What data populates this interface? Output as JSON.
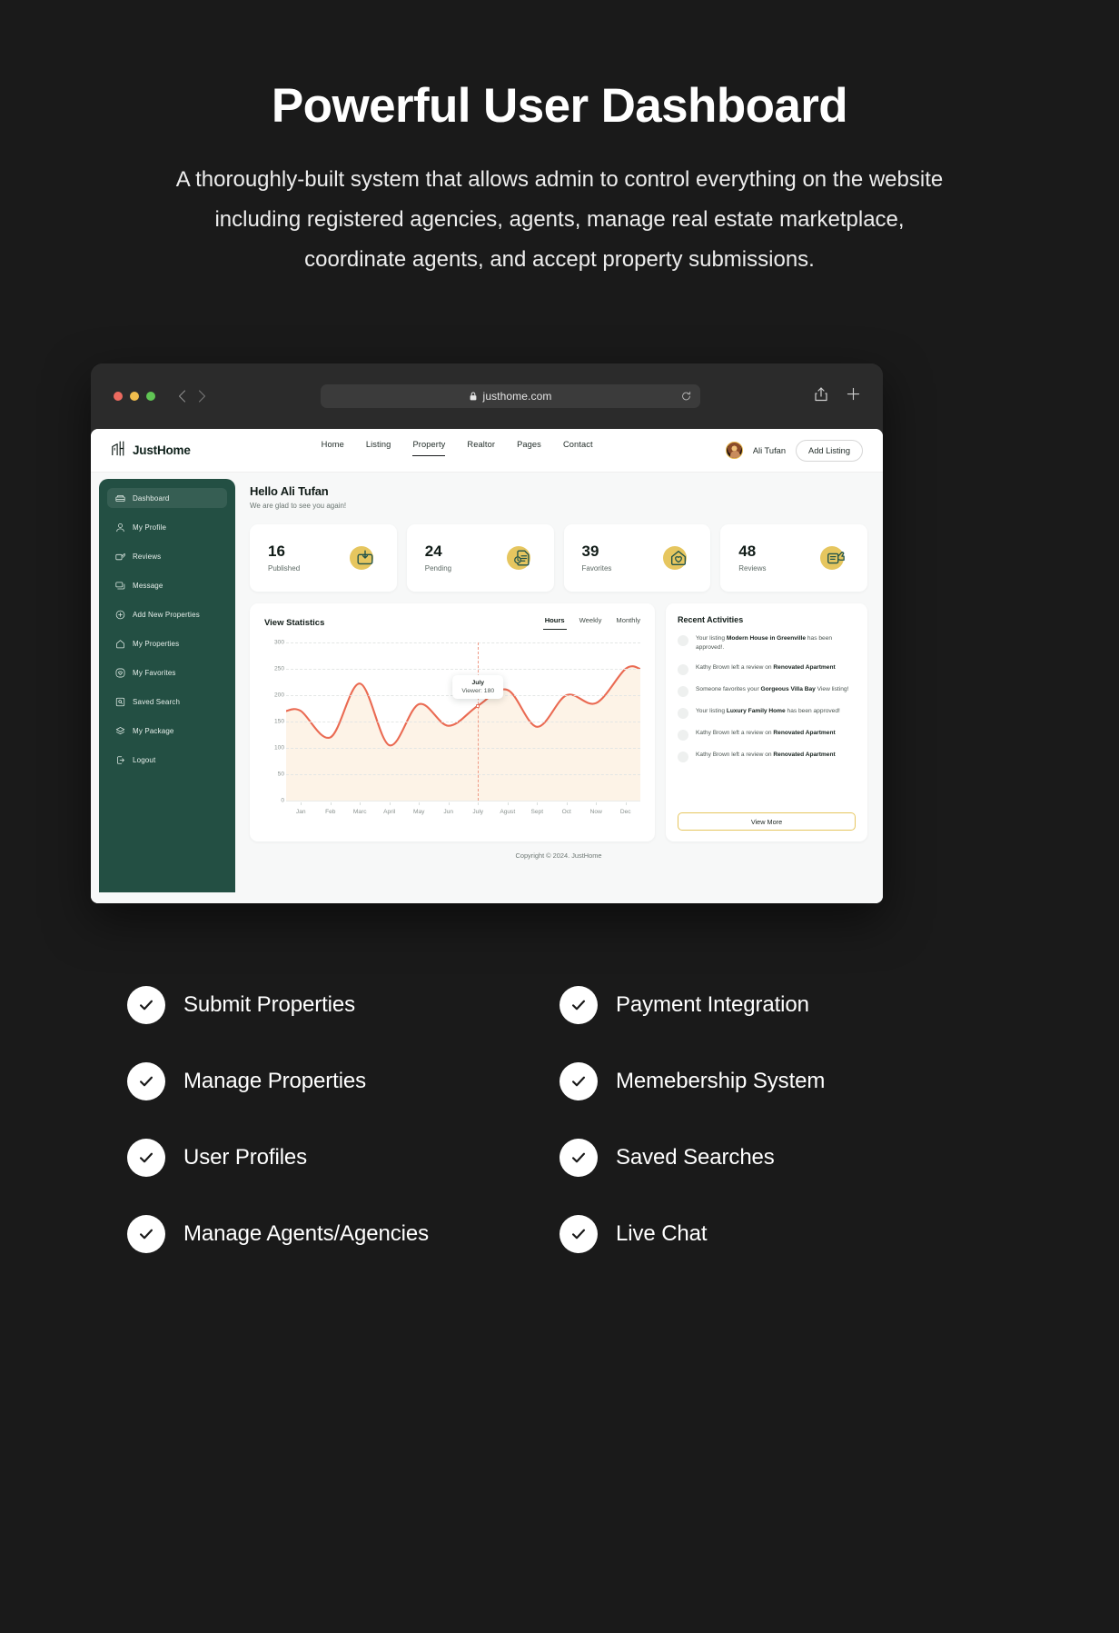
{
  "hero": {
    "title": "Powerful User Dashboard",
    "subtitle": "A thoroughly-built system that allows admin to control everything on the website including registered agencies, agents, manage real estate marketplace, coordinate agents, and accept property submissions."
  },
  "browser": {
    "url": "justhome.com",
    "lock_icon": "lock-icon",
    "reload_icon": "reload-icon",
    "back_icon": "chevron-left-icon",
    "forward_icon": "chevron-right-icon",
    "share_icon": "share-icon",
    "newtab_icon": "plus-icon"
  },
  "site_header": {
    "brand": "JustHome",
    "brand_icon": "building-icon",
    "nav": [
      {
        "label": "Home",
        "active": false
      },
      {
        "label": "Listing",
        "active": false
      },
      {
        "label": "Property",
        "active": true
      },
      {
        "label": "Realtor",
        "active": false
      },
      {
        "label": "Pages",
        "active": false
      },
      {
        "label": "Contact",
        "active": false
      }
    ],
    "user_name": "Ali Tufan",
    "add_listing_label": "Add Listing"
  },
  "sidebar": {
    "items": [
      {
        "label": "Dashboard",
        "icon": "dashboard-icon",
        "active": true
      },
      {
        "label": "My Profile",
        "icon": "user-icon",
        "active": false
      },
      {
        "label": "Reviews",
        "icon": "review-icon",
        "active": false
      },
      {
        "label": "Message",
        "icon": "message-icon",
        "active": false
      },
      {
        "label": "Add New Properties",
        "icon": "plus-circle-icon",
        "active": false
      },
      {
        "label": "My Properties",
        "icon": "home-icon",
        "active": false
      },
      {
        "label": "My Favorites",
        "icon": "heart-circle-icon",
        "active": false
      },
      {
        "label": "Saved Search",
        "icon": "saved-search-icon",
        "active": false
      },
      {
        "label": "My Package",
        "icon": "layers-icon",
        "active": false
      },
      {
        "label": "Logout",
        "icon": "logout-icon",
        "active": false
      }
    ]
  },
  "greeting": {
    "title": "Hello Ali Tufan",
    "subtitle": "We are glad to see you again!"
  },
  "stats": [
    {
      "value": "16",
      "label": "Published",
      "icon": "upload-box-icon"
    },
    {
      "value": "24",
      "label": "Pending",
      "icon": "pending-doc-icon"
    },
    {
      "value": "39",
      "label": "Favorites",
      "icon": "home-heart-icon"
    },
    {
      "value": "48",
      "label": "Reviews",
      "icon": "review-thumb-icon"
    }
  ],
  "chart_panel": {
    "title": "View Statistics",
    "ranges": [
      {
        "label": "Hours",
        "active": true
      },
      {
        "label": "Weekly",
        "active": false
      },
      {
        "label": "Monthly",
        "active": false
      }
    ]
  },
  "chart_data": {
    "type": "area",
    "title": "View Statistics",
    "xlabel": "",
    "ylabel": "",
    "categories": [
      "Jan",
      "Feb",
      "Marc",
      "April",
      "May",
      "Jun",
      "July",
      "Agust",
      "Sept",
      "Oct",
      "Now",
      "Dec"
    ],
    "yticks": [
      0,
      50,
      100,
      150,
      200,
      250,
      300
    ],
    "ylim": [
      0,
      300
    ],
    "grid": true,
    "legend": "none",
    "line_color": "#ea6a52",
    "fill_color": "#fdf3e7",
    "series": [
      {
        "name": "Views",
        "values": [
          170,
          120,
          222,
          105,
          183,
          142,
          180,
          210,
          140,
          200,
          185,
          250
        ]
      }
    ],
    "annotation": {
      "label": "July",
      "value_text": "Viewer: 180",
      "x_category": "July",
      "y_value": 180
    }
  },
  "activities": {
    "title": "Recent Activities",
    "items": [
      {
        "prefix": "Your listing ",
        "bold": "Modern House in Greenville",
        "suffix": " has been approved!."
      },
      {
        "prefix": "Kathy Brown left a review on ",
        "bold": "Renovated Apartment",
        "suffix": ""
      },
      {
        "prefix": "Someone favorites your ",
        "bold": "Gorgeous Villa Bay",
        "suffix": " View listing!"
      },
      {
        "prefix": "Your listing ",
        "bold": "Luxury Family Home",
        "suffix": " has been approved!"
      },
      {
        "prefix": "Kathy Brown left a review on ",
        "bold": "Renovated Apartment",
        "suffix": ""
      },
      {
        "prefix": "Kathy Brown left a review on ",
        "bold": "Renovated Apartment",
        "suffix": ""
      }
    ],
    "view_more_label": "View More"
  },
  "footer": {
    "copyright": "Copyright © 2024. JustHome"
  },
  "features": [
    {
      "label": "Submit Properties"
    },
    {
      "label": "Payment Integration"
    },
    {
      "label": "Manage Properties"
    },
    {
      "label": "Memebership System"
    },
    {
      "label": "User Profiles"
    },
    {
      "label": "Saved Searches"
    },
    {
      "label": "Manage Agents/Agencies"
    },
    {
      "label": "Live Chat"
    }
  ],
  "colors": {
    "background": "#1a1a1a",
    "sidebar_green": "#234f43",
    "accent_gold": "#e6c65f",
    "chart_line": "#ea6a52"
  }
}
